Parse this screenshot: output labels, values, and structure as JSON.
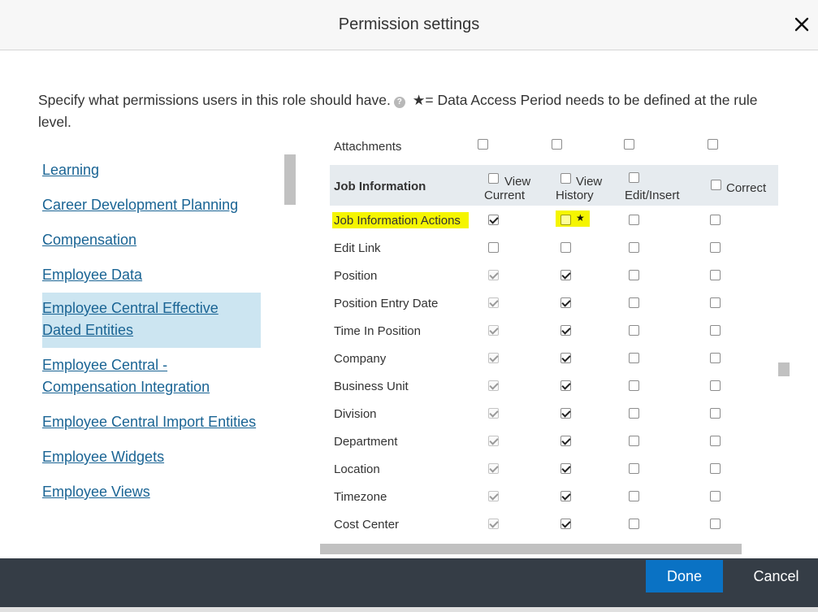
{
  "dialog": {
    "title": "Permission settings",
    "close_icon": "close-icon",
    "intro": "Specify what permissions users in this role should have.",
    "help_icon": "?",
    "star_note": "★= Data Access Period needs to be defined at the rule level."
  },
  "nav": {
    "items": [
      {
        "label": "Learning",
        "selected": false
      },
      {
        "label": "Career Development Planning",
        "selected": false
      },
      {
        "label": "Compensation",
        "selected": false
      },
      {
        "label": "Employee Data",
        "selected": false
      },
      {
        "label": "Employee Central Effective Dated Entities",
        "selected": true
      },
      {
        "label": "Employee Central - Compensation Integration",
        "selected": false
      },
      {
        "label": "Employee Central Import Entities",
        "selected": false
      },
      {
        "label": "Employee Widgets",
        "selected": false
      },
      {
        "label": "Employee Views",
        "selected": false
      }
    ]
  },
  "table": {
    "attachments_label": "Attachments",
    "section_label": "Job Information",
    "columns": [
      {
        "line1": "View",
        "line2": "Current"
      },
      {
        "line1": "View",
        "line2": "History"
      },
      {
        "line1": "",
        "line2": "Edit/Insert"
      },
      {
        "line1": "Correct",
        "line2": ""
      }
    ],
    "star": "★",
    "rows": [
      {
        "label": "Job Information Actions"
      },
      {
        "label": "Edit Link"
      },
      {
        "label": "Position"
      },
      {
        "label": "Position Entry Date"
      },
      {
        "label": "Time In Position"
      },
      {
        "label": "Company"
      },
      {
        "label": "Business Unit"
      },
      {
        "label": "Division"
      },
      {
        "label": "Department"
      },
      {
        "label": "Location"
      },
      {
        "label": "Timezone"
      },
      {
        "label": "Cost Center"
      }
    ]
  },
  "footer": {
    "done_label": "Done",
    "cancel_label": "Cancel"
  },
  "colors": {
    "accent": "#0a72c4",
    "footer_bg": "#353d46",
    "link": "#1a6494",
    "highlight": "#f5f500",
    "selected_nav": "#cce5f1"
  }
}
